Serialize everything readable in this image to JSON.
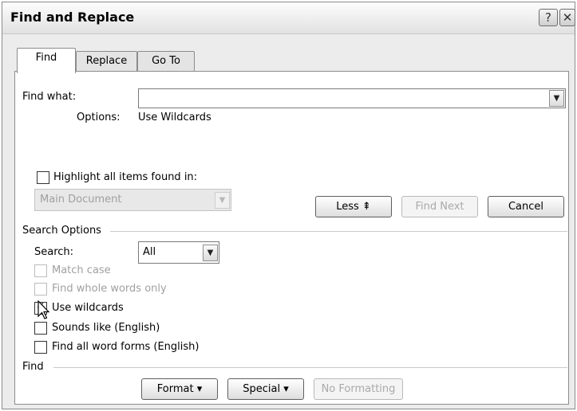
{
  "window": {
    "title": "Find and Replace",
    "help_label": "?",
    "close_label": "✕"
  },
  "tabs": [
    {
      "label": "Find",
      "active": true
    },
    {
      "label": "Replace",
      "active": false
    },
    {
      "label": "Go To",
      "active": false
    }
  ],
  "find": {
    "label": "Find what:",
    "value": "",
    "options_label": "Options:",
    "options_value": "Use Wildcards"
  },
  "highlight": {
    "label": "Highlight all items found in:",
    "checked": false,
    "scope_value": "Main Document"
  },
  "buttons": {
    "less": "Less ⇞",
    "find_next": "Find Next",
    "cancel": "Cancel",
    "format": "Format ▾",
    "special": "Special ▾",
    "no_formatting": "No Formatting"
  },
  "search_options": {
    "heading": "Search Options",
    "search_label": "Search:",
    "search_value": "All",
    "checkboxes": [
      {
        "label": "Match case",
        "checked": false,
        "enabled": false
      },
      {
        "label": "Find whole words only",
        "checked": false,
        "enabled": false
      },
      {
        "label": "Use wildcards",
        "checked": true,
        "enabled": true
      },
      {
        "label": "Sounds like (English)",
        "checked": false,
        "enabled": true
      },
      {
        "label": "Find all word forms (English)",
        "checked": false,
        "enabled": true
      }
    ]
  },
  "find_section": {
    "heading": "Find"
  },
  "icons": {
    "dropdown": "chevron-down-icon",
    "checkmark": "checkmark-icon",
    "cursor": "mouse-pointer-icon"
  }
}
